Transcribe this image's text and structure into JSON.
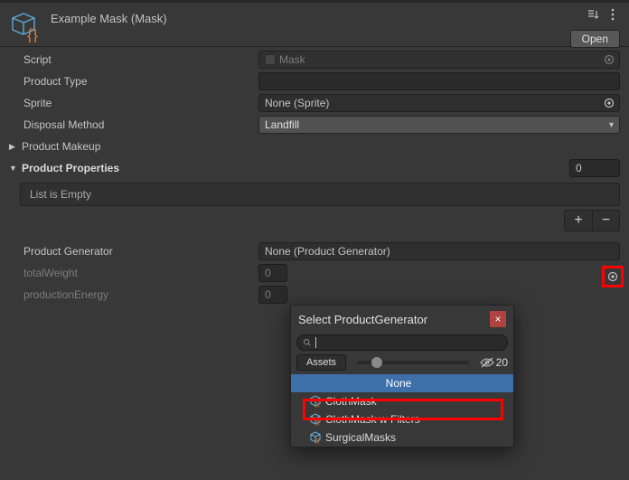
{
  "header": {
    "title": "Example Mask (Mask)",
    "open_label": "Open"
  },
  "props": {
    "script": {
      "label": "Script",
      "value": "Mask"
    },
    "productType": {
      "label": "Product Type",
      "value": ""
    },
    "sprite": {
      "label": "Sprite",
      "value": "None (Sprite)"
    },
    "disposalMethod": {
      "label": "Disposal Method",
      "value": "Landfill"
    },
    "productMakeup": {
      "label": "Product Makeup"
    },
    "productProperties": {
      "label": "Product Properties",
      "size": "0",
      "empty_text": "List is Empty"
    },
    "productGenerator": {
      "label": "Product Generator",
      "value": "None (Product Generator)"
    },
    "totalWeight": {
      "label": "totalWeight",
      "value": "0"
    },
    "productionEnergy": {
      "label": "productionEnergy",
      "value": "0"
    }
  },
  "popup": {
    "title": "Select ProductGenerator",
    "tab": "Assets",
    "count": "20",
    "items": [
      "None",
      "ClothMask",
      "ClothMask w Filters",
      "SurgicalMasks"
    ]
  },
  "colors": {
    "highlight": "#ff0000",
    "selection": "#3e6fa8"
  }
}
